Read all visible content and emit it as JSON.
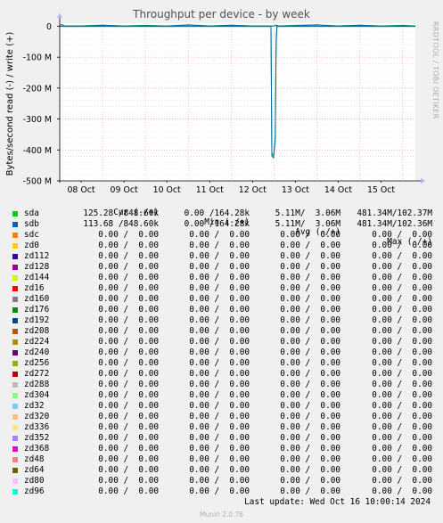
{
  "chart_data": {
    "type": "line",
    "title": "Throughput per device - by week",
    "ylabel": "Bytes/second read (-) / write (+)",
    "ylim": [
      -500000000,
      10000000
    ],
    "ytick_values": [
      0,
      -100000000,
      -200000000,
      -300000000,
      -400000000,
      -500000000
    ],
    "ytick_labels": [
      "0",
      "-100 M",
      "-200 M",
      "-300 M",
      "-400 M",
      "-500 M"
    ],
    "xlim": [
      0,
      8.3
    ],
    "xtick_values": [
      0.5,
      1.5,
      2.5,
      3.5,
      4.5,
      5.5,
      6.5,
      7.5
    ],
    "xtick_labels": [
      "08 Oct",
      "09 Oct",
      "10 Oct",
      "11 Oct",
      "12 Oct",
      "13 Oct",
      "14 Oct",
      "15 Oct"
    ],
    "grid": true,
    "series": [
      {
        "name": "sda",
        "color": "#00cc00",
        "write": [
          [
            0,
            3000000
          ],
          [
            0.05,
            6000000
          ],
          [
            0.1,
            1000000
          ],
          [
            0.5,
            1500000
          ],
          [
            1,
            4000000
          ],
          [
            1.5,
            1000000
          ],
          [
            2,
            3000000
          ],
          [
            2.5,
            1000000
          ],
          [
            3,
            5000000
          ],
          [
            3.5,
            1000000
          ],
          [
            4,
            4000000
          ],
          [
            4.5,
            1000000
          ],
          [
            4.98,
            1000000
          ],
          [
            5.0,
            1000000
          ],
          [
            5.05,
            4000000
          ],
          [
            5.1,
            1000000
          ],
          [
            5.5,
            3000000
          ],
          [
            6,
            5000000
          ],
          [
            6.5,
            1000000
          ],
          [
            7,
            4000000
          ],
          [
            7.5,
            1000000
          ],
          [
            8,
            3000000
          ],
          [
            8.3,
            1000000
          ]
        ],
        "read": [
          [
            0,
            -500000
          ],
          [
            1,
            -500000
          ],
          [
            2,
            -500000
          ],
          [
            3,
            -500000
          ],
          [
            4,
            -500000
          ],
          [
            4.93,
            -500000
          ],
          [
            4.95,
            -410000000
          ],
          [
            4.99,
            -420000000
          ],
          [
            5.03,
            -360000000
          ],
          [
            5.05,
            -40000000
          ],
          [
            5.07,
            -500000
          ],
          [
            6,
            -500000
          ],
          [
            7,
            -500000
          ],
          [
            8.3,
            -500000
          ]
        ]
      },
      {
        "name": "sdb",
        "color": "#0066b3",
        "write": [
          [
            0,
            2000000
          ],
          [
            0.05,
            5000000
          ],
          [
            0.1,
            1000000
          ],
          [
            0.5,
            1000000
          ],
          [
            1,
            3000000
          ],
          [
            1.5,
            1000000
          ],
          [
            2,
            2000000
          ],
          [
            2.5,
            1000000
          ],
          [
            3,
            4000000
          ],
          [
            3.5,
            1000000
          ],
          [
            4,
            3000000
          ],
          [
            4.5,
            1000000
          ],
          [
            4.98,
            1000000
          ],
          [
            5.0,
            1000000
          ],
          [
            5.05,
            3000000
          ],
          [
            5.1,
            1000000
          ],
          [
            5.5,
            2000000
          ],
          [
            6,
            4000000
          ],
          [
            6.5,
            1000000
          ],
          [
            7,
            3000000
          ],
          [
            7.5,
            1000000
          ],
          [
            8,
            2000000
          ],
          [
            8.3,
            1000000
          ]
        ],
        "read": [
          [
            0,
            -500000
          ],
          [
            1,
            -500000
          ],
          [
            2,
            -500000
          ],
          [
            3,
            -500000
          ],
          [
            4,
            -500000
          ],
          [
            4.93,
            -500000
          ],
          [
            4.95,
            -420000000
          ],
          [
            4.99,
            -425000000
          ],
          [
            5.03,
            -370000000
          ],
          [
            5.05,
            -60000000
          ],
          [
            5.07,
            -500000
          ],
          [
            6,
            -500000
          ],
          [
            7,
            -500000
          ],
          [
            8.3,
            -500000
          ]
        ]
      }
    ]
  },
  "side_label": "RRDTOOL / TOBI OETIKER",
  "legend": {
    "headers": {
      "cur": "Cur (-/+)",
      "min": "Min (-/+)",
      "avg": "Avg (-/+)",
      "max": "Max (-/+)"
    },
    "rows": [
      {
        "name": "sda",
        "color": "#00cc00",
        "cur": "125.28 /848.60k",
        "min": "0.00 /164.28k",
        "avg": "5.11M/  3.06M",
        "max": "481.34M/102.37M"
      },
      {
        "name": "sdb",
        "color": "#0066b3",
        "cur": "113.68 /848.60k",
        "min": "0.00 /164.28k",
        "avg": "5.11M/  3.06M",
        "max": "481.34M/102.36M"
      },
      {
        "name": "sdc",
        "color": "#ff8000",
        "cur": "0.00 /  0.00",
        "min": "0.00 /  0.00",
        "avg": "0.00 /  0.00",
        "max": "0.00 /  0.00"
      },
      {
        "name": "zd0",
        "color": "#ffcc00",
        "cur": "0.00 /  0.00",
        "min": "0.00 /  0.00",
        "avg": "0.00 /  0.00",
        "max": "0.00 /  0.00"
      },
      {
        "name": "zd112",
        "color": "#330099",
        "cur": "0.00 /  0.00",
        "min": "0.00 /  0.00",
        "avg": "0.00 /  0.00",
        "max": "0.00 /  0.00"
      },
      {
        "name": "zd128",
        "color": "#990099",
        "cur": "0.00 /  0.00",
        "min": "0.00 /  0.00",
        "avg": "0.00 /  0.00",
        "max": "0.00 /  0.00"
      },
      {
        "name": "zd144",
        "color": "#ccff00",
        "cur": "0.00 /  0.00",
        "min": "0.00 /  0.00",
        "avg": "0.00 /  0.00",
        "max": "0.00 /  0.00"
      },
      {
        "name": "zd16",
        "color": "#ff0000",
        "cur": "0.00 /  0.00",
        "min": "0.00 /  0.00",
        "avg": "0.00 /  0.00",
        "max": "0.00 /  0.00"
      },
      {
        "name": "zd160",
        "color": "#808080",
        "cur": "0.00 /  0.00",
        "min": "0.00 /  0.00",
        "avg": "0.00 /  0.00",
        "max": "0.00 /  0.00"
      },
      {
        "name": "zd176",
        "color": "#008f00",
        "cur": "0.00 /  0.00",
        "min": "0.00 /  0.00",
        "avg": "0.00 /  0.00",
        "max": "0.00 /  0.00"
      },
      {
        "name": "zd192",
        "color": "#00487d",
        "cur": "0.00 /  0.00",
        "min": "0.00 /  0.00",
        "avg": "0.00 /  0.00",
        "max": "0.00 /  0.00"
      },
      {
        "name": "zd208",
        "color": "#b35a00",
        "cur": "0.00 /  0.00",
        "min": "0.00 /  0.00",
        "avg": "0.00 /  0.00",
        "max": "0.00 /  0.00"
      },
      {
        "name": "zd224",
        "color": "#b38f00",
        "cur": "0.00 /  0.00",
        "min": "0.00 /  0.00",
        "avg": "0.00 /  0.00",
        "max": "0.00 /  0.00"
      },
      {
        "name": "zd240",
        "color": "#6b006b",
        "cur": "0.00 /  0.00",
        "min": "0.00 /  0.00",
        "avg": "0.00 /  0.00",
        "max": "0.00 /  0.00"
      },
      {
        "name": "zd256",
        "color": "#8fb300",
        "cur": "0.00 /  0.00",
        "min": "0.00 /  0.00",
        "avg": "0.00 /  0.00",
        "max": "0.00 /  0.00"
      },
      {
        "name": "zd272",
        "color": "#b30000",
        "cur": "0.00 /  0.00",
        "min": "0.00 /  0.00",
        "avg": "0.00 /  0.00",
        "max": "0.00 /  0.00"
      },
      {
        "name": "zd288",
        "color": "#bebebe",
        "cur": "0.00 /  0.00",
        "min": "0.00 /  0.00",
        "avg": "0.00 /  0.00",
        "max": "0.00 /  0.00"
      },
      {
        "name": "zd304",
        "color": "#80ff80",
        "cur": "0.00 /  0.00",
        "min": "0.00 /  0.00",
        "avg": "0.00 /  0.00",
        "max": "0.00 /  0.00"
      },
      {
        "name": "zd32",
        "color": "#80c9ff",
        "cur": "0.00 /  0.00",
        "min": "0.00 /  0.00",
        "avg": "0.00 /  0.00",
        "max": "0.00 /  0.00"
      },
      {
        "name": "zd320",
        "color": "#ffc080",
        "cur": "0.00 /  0.00",
        "min": "0.00 /  0.00",
        "avg": "0.00 /  0.00",
        "max": "0.00 /  0.00"
      },
      {
        "name": "zd336",
        "color": "#ffe680",
        "cur": "0.00 /  0.00",
        "min": "0.00 /  0.00",
        "avg": "0.00 /  0.00",
        "max": "0.00 /  0.00"
      },
      {
        "name": "zd352",
        "color": "#aa80ff",
        "cur": "0.00 /  0.00",
        "min": "0.00 /  0.00",
        "avg": "0.00 /  0.00",
        "max": "0.00 /  0.00"
      },
      {
        "name": "zd368",
        "color": "#ee00cc",
        "cur": "0.00 /  0.00",
        "min": "0.00 /  0.00",
        "avg": "0.00 /  0.00",
        "max": "0.00 /  0.00"
      },
      {
        "name": "zd48",
        "color": "#ff8080",
        "cur": "0.00 /  0.00",
        "min": "0.00 /  0.00",
        "avg": "0.00 /  0.00",
        "max": "0.00 /  0.00"
      },
      {
        "name": "zd64",
        "color": "#666600",
        "cur": "0.00 /  0.00",
        "min": "0.00 /  0.00",
        "avg": "0.00 /  0.00",
        "max": "0.00 /  0.00"
      },
      {
        "name": "zd80",
        "color": "#ffbfff",
        "cur": "0.00 /  0.00",
        "min": "0.00 /  0.00",
        "avg": "0.00 /  0.00",
        "max": "0.00 /  0.00"
      },
      {
        "name": "zd96",
        "color": "#00ffcc",
        "cur": "0.00 /  0.00",
        "min": "0.00 /  0.00",
        "avg": "0.00 /  0.00",
        "max": "0.00 /  0.00"
      }
    ]
  },
  "last_update": "Last update: Wed Oct 16 10:00:14 2024",
  "footer_version": "Munin 2.0.76"
}
